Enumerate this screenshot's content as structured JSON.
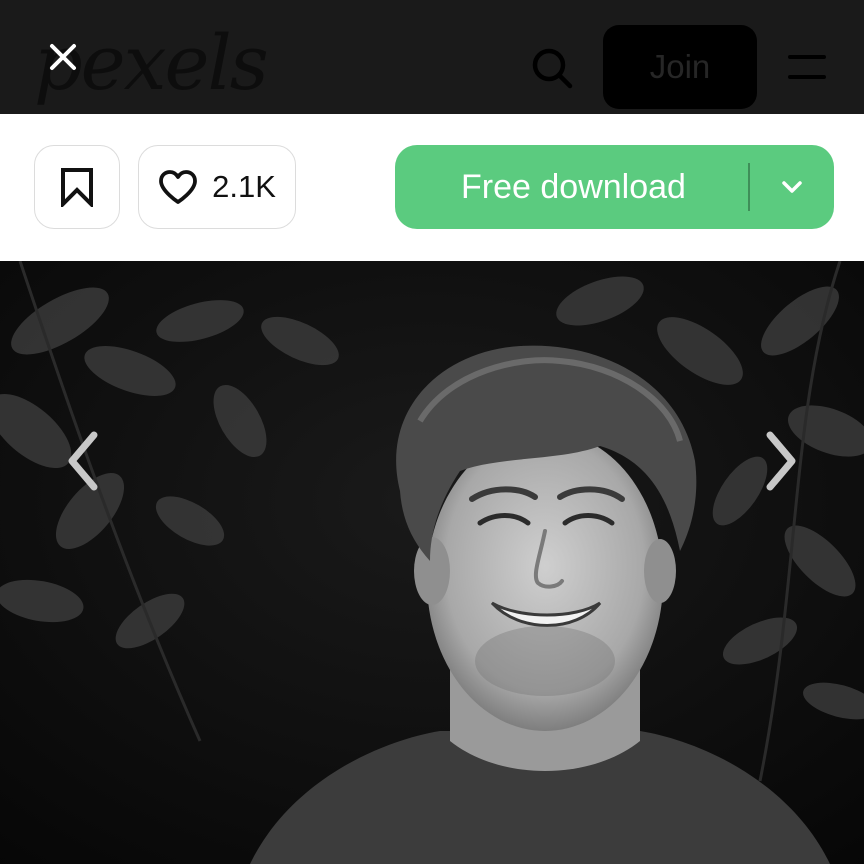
{
  "header": {
    "logo_text": "pexels",
    "join_label": "Join",
    "icons": {
      "close": "close-icon",
      "search": "search-icon",
      "menu": "menu-icon"
    }
  },
  "actions": {
    "like_count": "2.1K",
    "download_label": "Free download",
    "icons": {
      "bookmark": "bookmark-icon",
      "like": "heart-icon",
      "download_options": "chevron-down-icon"
    }
  },
  "photo": {
    "subject": "black-and-white portrait of smiling young man with curly hair in front of leaves",
    "nav": {
      "prev": "chevron-left-icon",
      "next": "chevron-right-icon"
    }
  },
  "colors": {
    "header_bg": "#1a1a1a",
    "download_green": "#5bcb7f",
    "join_bg": "#000000"
  }
}
